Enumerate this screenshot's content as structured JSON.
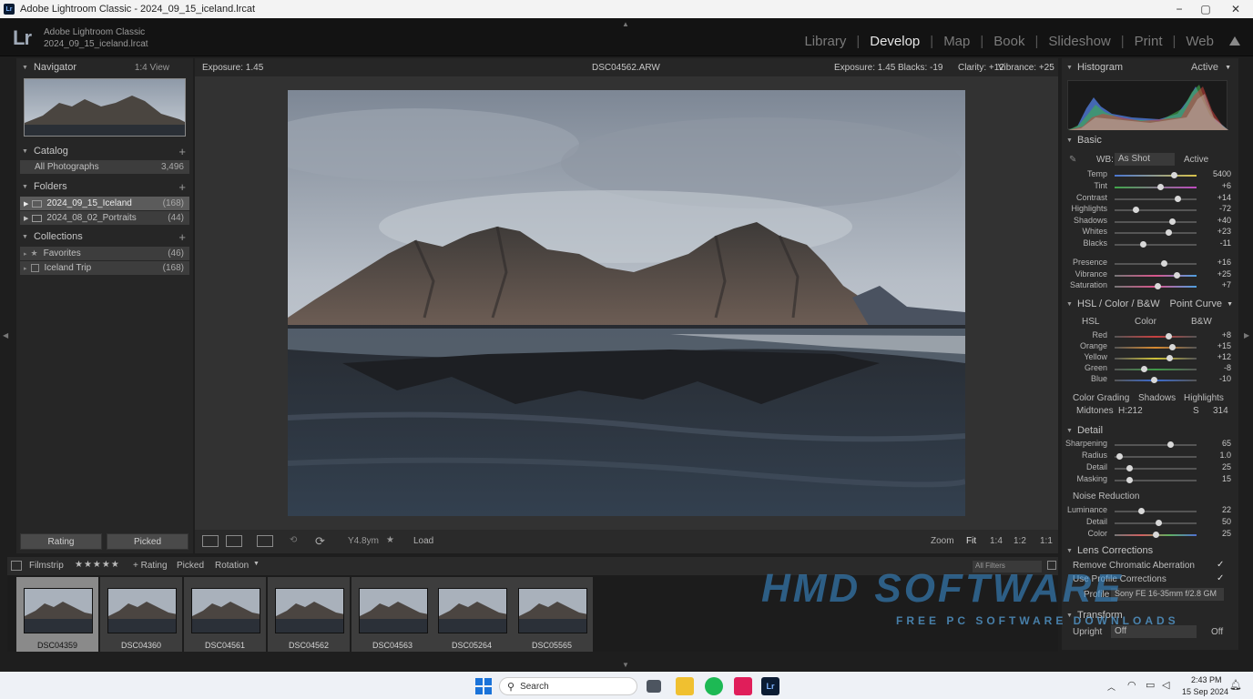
{
  "window": {
    "title": "Adobe Lightroom Classic - 2024_09_15_iceland.lrcat",
    "minimize": "−",
    "maximize": "▢",
    "close": "✕"
  },
  "identity": {
    "logo": "Lr",
    "app_name": "Adobe Lightroom Classic",
    "catalog": "2024_09_15_iceland.lrcat"
  },
  "modules": [
    "Library",
    "Develop",
    "Map",
    "Book",
    "Slideshow",
    "Print",
    "Web"
  ],
  "active_module": "Develop",
  "navigator": {
    "title": "Navigator",
    "view": "1:4 View"
  },
  "catalog": {
    "title": "Catalog",
    "items": [
      {
        "label": "All Photographs",
        "count": "3,496"
      }
    ]
  },
  "folders": {
    "title": "Folders",
    "items": [
      {
        "label": "2024_09_15_Iceland",
        "count": "(168)"
      },
      {
        "label": "2024_08_02_Portraits",
        "count": "(44)"
      }
    ]
  },
  "collections": {
    "title": "Collections",
    "items": [
      {
        "label": "Favorites",
        "count": "(46)"
      },
      {
        "label": "Iceland Trip",
        "count": "(168)"
      }
    ]
  },
  "left_buttons": {
    "rating": "Rating",
    "picked": "Picked"
  },
  "infobar": {
    "exposure_left": "Exposure: 1.45",
    "filename": "DSC04562.ARW",
    "exposure": "Exposure: 1.45",
    "blacks": "Blacks: -19",
    "clarity": "Clarity: +12",
    "vibrance": "Vibrance: +25"
  },
  "toolbar": {
    "tool_text": "Y4.8ym",
    "load": "Load",
    "zoom": "Zoom",
    "fit": "Fit",
    "z1": "1:4",
    "z2": "1:2",
    "z3": "1:1"
  },
  "histogram": {
    "title": "Histogram",
    "mode": "Active"
  },
  "basic": {
    "title": "Basic",
    "wb_label": "WB:",
    "wb_value": "As Shot",
    "wb_mode": "Active",
    "sliders": [
      {
        "label": "Temp",
        "value": "5400",
        "pos": 0.72,
        "grad": "temp"
      },
      {
        "label": "Tint",
        "value": "+6",
        "pos": 0.56,
        "grad": "tint"
      },
      {
        "label": "Contrast",
        "value": "+14",
        "pos": 0.77,
        "grad": ""
      },
      {
        "label": "Highlights",
        "value": "-72",
        "pos": 0.26,
        "grad": ""
      },
      {
        "label": "Shadows",
        "value": "+40",
        "pos": 0.7,
        "grad": ""
      },
      {
        "label": "Whites",
        "value": "+23",
        "pos": 0.66,
        "grad": ""
      },
      {
        "label": "Blacks",
        "value": "-11",
        "pos": 0.34,
        "grad": ""
      },
      {
        "label": "Presence",
        "value": "+16",
        "pos": 0.6,
        "grad": ""
      },
      {
        "label": "Vibrance",
        "value": "+25",
        "pos": 0.75,
        "grad": "vib"
      },
      {
        "label": "Saturation",
        "value": "+7",
        "pos": 0.52,
        "grad": "sat"
      }
    ]
  },
  "hsl": {
    "title": "HSL / Color / B&W",
    "curve": "Point Curve",
    "tabs": [
      "HSL",
      "Color",
      "B&W"
    ],
    "sliders": [
      {
        "label": "Red",
        "value": "+8",
        "pos": 0.66,
        "color": "#c94040"
      },
      {
        "label": "Orange",
        "value": "+15",
        "pos": 0.7,
        "color": "#d88a30"
      },
      {
        "label": "Yellow",
        "value": "+12",
        "pos": 0.67,
        "color": "#cfc23a"
      },
      {
        "label": "Green",
        "value": "-8",
        "pos": 0.35,
        "color": "#3f9a48"
      },
      {
        "label": "Blue",
        "value": "-10",
        "pos": 0.48,
        "color": "#3b6bd0"
      }
    ],
    "grading_tabs": [
      "Color Grading",
      "Shadows",
      "Highlights"
    ],
    "midtones_label": "Midtones",
    "midtones_h": "H:212",
    "midtones_s": "S",
    "midtones_val": "314"
  },
  "detail": {
    "title": "Detail",
    "sliders": [
      {
        "label": "Sharpening",
        "value": "65",
        "pos": 0.68
      },
      {
        "label": "Radius",
        "value": "1.0",
        "pos": 0.05
      },
      {
        "label": "Detail",
        "value": "25",
        "pos": 0.18
      },
      {
        "label": "Masking",
        "value": "15",
        "pos": 0.18
      }
    ],
    "noise_title": "Noise Reduction",
    "noise": [
      {
        "label": "Luminance",
        "value": "22",
        "pos": 0.32,
        "grad": ""
      },
      {
        "label": "Detail",
        "value": "50",
        "pos": 0.53,
        "grad": ""
      },
      {
        "label": "Color",
        "value": "25",
        "pos": 0.5,
        "grad": "col"
      }
    ]
  },
  "lens": {
    "title": "Lens Corrections",
    "remove_ca": "Remove Chromatic Aberration",
    "use_profile": "Use Profile Corrections",
    "profile_label": "Profile",
    "profile_value": "Sony FE 16-35mm f/2.8 GM"
  },
  "transform": {
    "title": "Transform",
    "upright_label": "Upright",
    "upright_value": "Off",
    "off": "Off"
  },
  "filmbar": {
    "filmstrip": "Filmstrip",
    "rating": "+ Rating",
    "picked": "Picked",
    "rotation": "Rotation",
    "filter": "All Filters"
  },
  "thumbs": [
    "DSC04359",
    "DSC04360",
    "DSC04561",
    "DSC04562",
    "DSC04563",
    "DSC05264",
    "DSC05565"
  ],
  "watermark": {
    "brand": "HMD SOFTWARE",
    "tagline": "FREE PC SOFTWARE DOWNLOADS"
  },
  "taskbar": {
    "search": "Search",
    "time": "2:43 PM",
    "date": "15 Sep 2024"
  }
}
